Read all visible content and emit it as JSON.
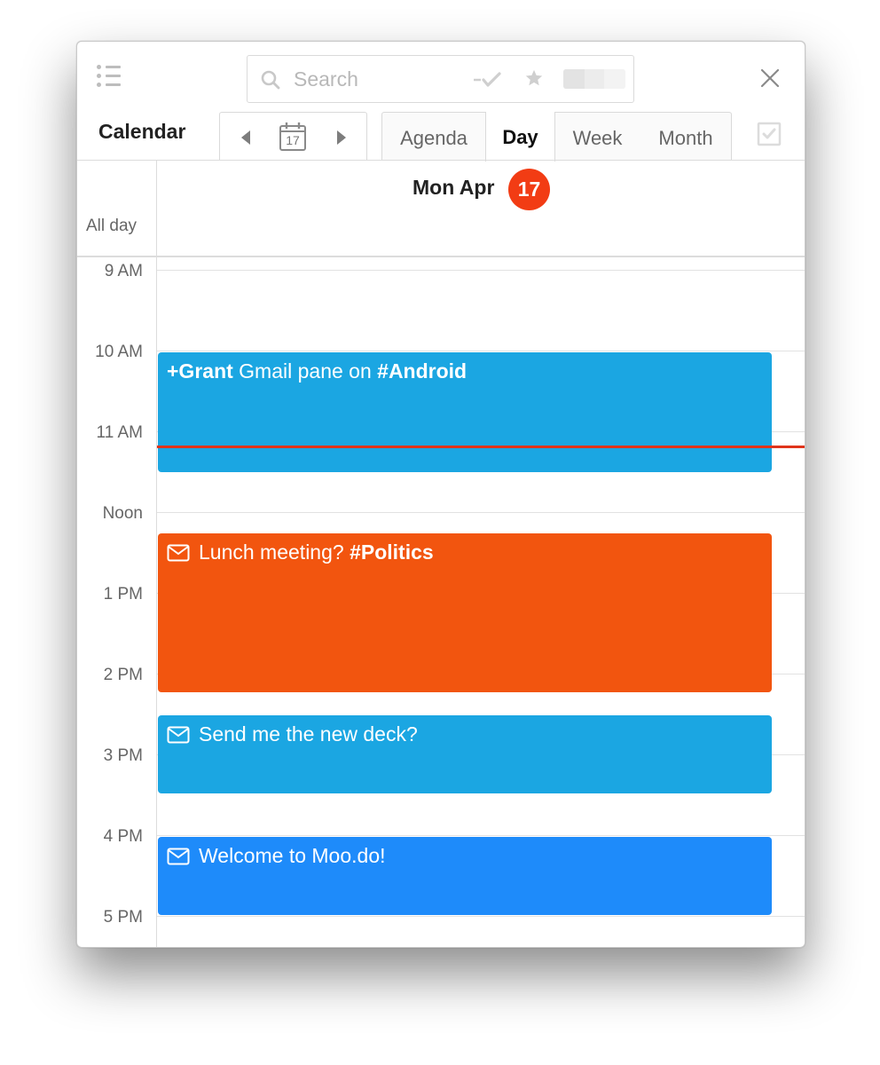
{
  "toolbar": {
    "search_placeholder": "Search",
    "calendar_title": "Calendar",
    "today_button_day": "17"
  },
  "view_tabs": [
    {
      "label": "Agenda",
      "active": false
    },
    {
      "label": "Day",
      "active": true
    },
    {
      "label": "Week",
      "active": false
    },
    {
      "label": "Month",
      "active": false
    }
  ],
  "day_header": {
    "label": "Mon Apr",
    "day_number": "17",
    "badge_color": "#f23c14"
  },
  "all_day_label": "All day",
  "hours": [
    "9 AM",
    "10 AM",
    "11 AM",
    "Noon",
    "1 PM",
    "2 PM",
    "3 PM",
    "4 PM",
    "5 PM"
  ],
  "events": [
    {
      "prefix_bold": "+Grant",
      "text": " Gmail pane on ",
      "suffix_bold": "#Android",
      "color": "#1ba6e2",
      "icon": "none",
      "start": "10:00 AM",
      "end": "11:30 AM"
    },
    {
      "prefix_bold": "",
      "text": "Lunch meeting?  ",
      "suffix_bold": "#Politics",
      "color": "#f2550f",
      "icon": "mail-icon",
      "start": "12:15 PM",
      "end": "2:15 PM"
    },
    {
      "prefix_bold": "",
      "text": "Send me the new deck?",
      "suffix_bold": "",
      "color": "#1ba6e2",
      "icon": "mail-icon",
      "start": "2:30 PM",
      "end": "3:30 PM"
    },
    {
      "prefix_bold": "",
      "text": "Welcome to Moo.do!",
      "suffix_bold": "",
      "color": "#1e8bfa",
      "icon": "mail-icon",
      "start": "4:00 PM",
      "end": "5:00 PM"
    }
  ],
  "current_time": "11:10 AM",
  "colors": {
    "current_time_line": "#e0341b",
    "accent": "#f23c14"
  }
}
